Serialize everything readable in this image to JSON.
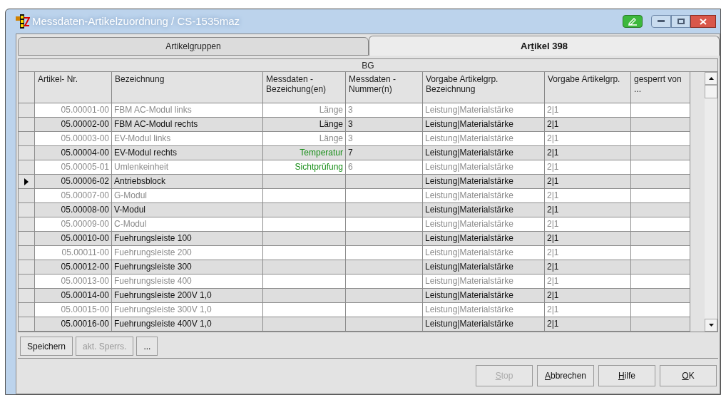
{
  "window": {
    "title": "Messdaten-Artikelzuordnung / CS-1535maz"
  },
  "tabs": [
    {
      "label_parts": [
        "Artikel",
        "g",
        "ruppen"
      ],
      "selected": false
    },
    {
      "label_parts": [
        "Ar",
        "t",
        "ikel 398"
      ],
      "selected": true
    }
  ],
  "table": {
    "band": "BG",
    "columns": [
      "Artikel- Nr.",
      "Bezeichnung",
      "Messdaten - Bezeichung(en)",
      "Messdaten - Nummer(n)",
      "Vorgabe Artikelgrp. Bezeichnung",
      "Vorgabe Artikelgrp.",
      "gesperrt von ..."
    ],
    "rows": [
      {
        "nr": "05.00001-00",
        "name": "FBM AC-Modul links",
        "measure": "Länge",
        "number": "3",
        "group_name": "Leistung|Materialstärke",
        "group": "2|1",
        "greyed": true,
        "highlight": false,
        "current": false
      },
      {
        "nr": "05.00002-00",
        "name": "FBM AC-Modul rechts",
        "measure": "Länge",
        "number": "3",
        "group_name": "Leistung|Materialstärke",
        "group": "2|1",
        "greyed": false,
        "highlight": false,
        "current": false
      },
      {
        "nr": "05.00003-00",
        "name": "EV-Modul links",
        "measure": "Länge",
        "number": "3",
        "group_name": "Leistung|Materialstärke",
        "group": "2|1",
        "greyed": true,
        "highlight": false,
        "current": false
      },
      {
        "nr": "05.00004-00",
        "name": "EV-Modul rechts",
        "measure": "Temperatur",
        "number": "7",
        "group_name": "Leistung|Materialstärke",
        "group": "2|1",
        "greyed": false,
        "highlight": true,
        "current": false
      },
      {
        "nr": "05.00005-01",
        "name": "Umlenkeinheit",
        "measure": "Sichtprüfung",
        "number": "6",
        "group_name": "Leistung|Materialstärke",
        "group": "2|1",
        "greyed": true,
        "highlight": true,
        "current": false
      },
      {
        "nr": "05.00006-02",
        "name": "Antriebsblock",
        "group_name": "Leistung|Materialstärke",
        "group": "2|1",
        "greyed": false,
        "highlight": false,
        "current": true
      },
      {
        "nr": "05.00007-00",
        "name": "G-Modul",
        "group_name": "Leistung|Materialstärke",
        "group": "2|1",
        "greyed": true,
        "highlight": false,
        "current": false
      },
      {
        "nr": "05.00008-00",
        "name": "V-Modul",
        "group_name": "Leistung|Materialstärke",
        "group": "2|1",
        "greyed": false,
        "highlight": false,
        "current": false
      },
      {
        "nr": "05.00009-00",
        "name": "C-Modul",
        "group_name": "Leistung|Materialstärke",
        "group": "2|1",
        "greyed": true,
        "highlight": false,
        "current": false
      },
      {
        "nr": "05.00010-00",
        "name": "Fuehrungsleiste 100",
        "group_name": "Leistung|Materialstärke",
        "group": "2|1",
        "greyed": false,
        "highlight": false,
        "current": false
      },
      {
        "nr": "05.00011-00",
        "name": "Fuehrungsleiste 200",
        "group_name": "Leistung|Materialstärke",
        "group": "2|1",
        "greyed": true,
        "highlight": false,
        "current": false
      },
      {
        "nr": "05.00012-00",
        "name": "Fuehrungsleiste 300",
        "group_name": "Leistung|Materialstärke",
        "group": "2|1",
        "greyed": false,
        "highlight": false,
        "current": false
      },
      {
        "nr": "05.00013-00",
        "name": "Fuehrungsleiste 400",
        "group_name": "Leistung|Materialstärke",
        "group": "2|1",
        "greyed": true,
        "highlight": false,
        "current": false
      },
      {
        "nr": "05.00014-00",
        "name": "Fuehrungsleiste 200V 1,0",
        "group_name": "Leistung|Materialstärke",
        "group": "2|1",
        "greyed": false,
        "highlight": false,
        "current": false
      },
      {
        "nr": "05.00015-00",
        "name": "Fuehrungsleiste 300V 1,0",
        "group_name": "Leistung|Materialstärke",
        "group": "2|1",
        "greyed": true,
        "highlight": false,
        "current": false
      },
      {
        "nr": "05.00016-00",
        "name": "Fuehrungsleiste 400V 1,0",
        "group_name": "Leistung|Materialstärke",
        "group": "2|1",
        "greyed": false,
        "highlight": false,
        "current": false
      }
    ]
  },
  "grid_buttons": [
    {
      "label": "Speichern",
      "disabled": false
    },
    {
      "label": "akt. Sperrs.",
      "disabled": true
    },
    {
      "label": "...",
      "disabled": false
    }
  ],
  "dialog_buttons": [
    {
      "access_key": "S",
      "rest": "top",
      "disabled": true
    },
    {
      "access_key": "A",
      "rest": "bbrechen",
      "disabled": false
    },
    {
      "access_key": "H",
      "rest": "ilfe",
      "disabled": false
    },
    {
      "access_key": "O",
      "rest": "K",
      "disabled": false
    }
  ]
}
